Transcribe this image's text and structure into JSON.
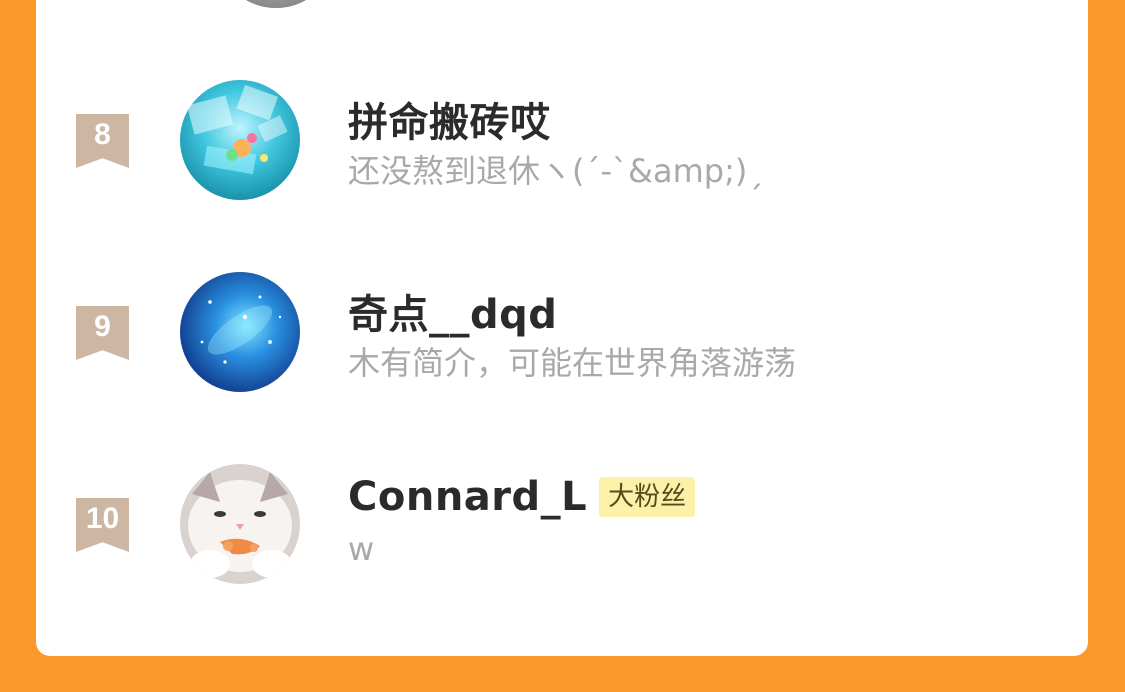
{
  "colors": {
    "page_background": "#fb9a2a",
    "card_background": "#ffffff",
    "rank_badge": "#cdb6a2",
    "fan_badge_background": "#fdf0a8"
  },
  "list": [
    {
      "rank": "8",
      "name": "拼命搬砖哎",
      "description": "还没熬到退休ヽ(ˊ-ˋ&amp;)ˏ",
      "avatar_icon": "sea-glass-avatar"
    },
    {
      "rank": "9",
      "name": "奇点__dqd",
      "description": "木有简介，可能在世界角落游荡",
      "avatar_icon": "blue-galaxy-avatar"
    },
    {
      "rank": "10",
      "name": "Connard_L",
      "badge": "大粉丝",
      "description": "w",
      "avatar_icon": "cat-avatar"
    }
  ]
}
